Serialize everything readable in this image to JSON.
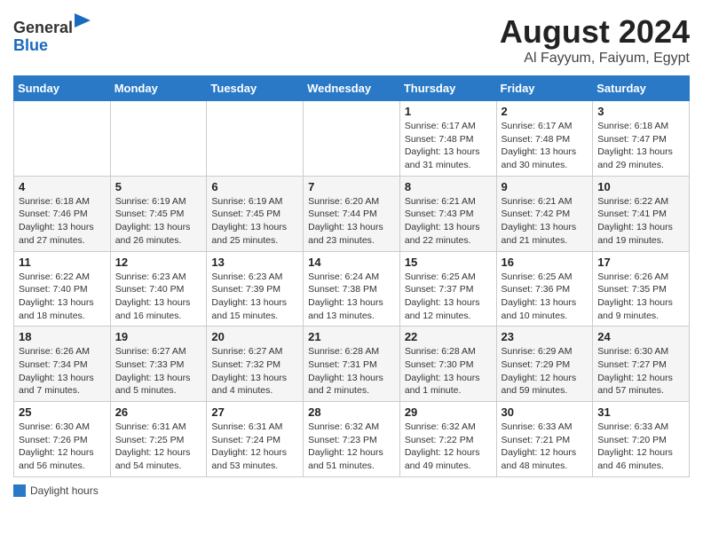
{
  "header": {
    "logo_line1": "General",
    "logo_line2": "Blue",
    "month": "August 2024",
    "location": "Al Fayyum, Faiyum, Egypt"
  },
  "days_of_week": [
    "Sunday",
    "Monday",
    "Tuesday",
    "Wednesday",
    "Thursday",
    "Friday",
    "Saturday"
  ],
  "weeks": [
    [
      {
        "day": "",
        "info": ""
      },
      {
        "day": "",
        "info": ""
      },
      {
        "day": "",
        "info": ""
      },
      {
        "day": "",
        "info": ""
      },
      {
        "day": "1",
        "info": "Sunrise: 6:17 AM\nSunset: 7:48 PM\nDaylight: 13 hours and 31 minutes."
      },
      {
        "day": "2",
        "info": "Sunrise: 6:17 AM\nSunset: 7:48 PM\nDaylight: 13 hours and 30 minutes."
      },
      {
        "day": "3",
        "info": "Sunrise: 6:18 AM\nSunset: 7:47 PM\nDaylight: 13 hours and 29 minutes."
      }
    ],
    [
      {
        "day": "4",
        "info": "Sunrise: 6:18 AM\nSunset: 7:46 PM\nDaylight: 13 hours and 27 minutes."
      },
      {
        "day": "5",
        "info": "Sunrise: 6:19 AM\nSunset: 7:45 PM\nDaylight: 13 hours and 26 minutes."
      },
      {
        "day": "6",
        "info": "Sunrise: 6:19 AM\nSunset: 7:45 PM\nDaylight: 13 hours and 25 minutes."
      },
      {
        "day": "7",
        "info": "Sunrise: 6:20 AM\nSunset: 7:44 PM\nDaylight: 13 hours and 23 minutes."
      },
      {
        "day": "8",
        "info": "Sunrise: 6:21 AM\nSunset: 7:43 PM\nDaylight: 13 hours and 22 minutes."
      },
      {
        "day": "9",
        "info": "Sunrise: 6:21 AM\nSunset: 7:42 PM\nDaylight: 13 hours and 21 minutes."
      },
      {
        "day": "10",
        "info": "Sunrise: 6:22 AM\nSunset: 7:41 PM\nDaylight: 13 hours and 19 minutes."
      }
    ],
    [
      {
        "day": "11",
        "info": "Sunrise: 6:22 AM\nSunset: 7:40 PM\nDaylight: 13 hours and 18 minutes."
      },
      {
        "day": "12",
        "info": "Sunrise: 6:23 AM\nSunset: 7:40 PM\nDaylight: 13 hours and 16 minutes."
      },
      {
        "day": "13",
        "info": "Sunrise: 6:23 AM\nSunset: 7:39 PM\nDaylight: 13 hours and 15 minutes."
      },
      {
        "day": "14",
        "info": "Sunrise: 6:24 AM\nSunset: 7:38 PM\nDaylight: 13 hours and 13 minutes."
      },
      {
        "day": "15",
        "info": "Sunrise: 6:25 AM\nSunset: 7:37 PM\nDaylight: 13 hours and 12 minutes."
      },
      {
        "day": "16",
        "info": "Sunrise: 6:25 AM\nSunset: 7:36 PM\nDaylight: 13 hours and 10 minutes."
      },
      {
        "day": "17",
        "info": "Sunrise: 6:26 AM\nSunset: 7:35 PM\nDaylight: 13 hours and 9 minutes."
      }
    ],
    [
      {
        "day": "18",
        "info": "Sunrise: 6:26 AM\nSunset: 7:34 PM\nDaylight: 13 hours and 7 minutes."
      },
      {
        "day": "19",
        "info": "Sunrise: 6:27 AM\nSunset: 7:33 PM\nDaylight: 13 hours and 5 minutes."
      },
      {
        "day": "20",
        "info": "Sunrise: 6:27 AM\nSunset: 7:32 PM\nDaylight: 13 hours and 4 minutes."
      },
      {
        "day": "21",
        "info": "Sunrise: 6:28 AM\nSunset: 7:31 PM\nDaylight: 13 hours and 2 minutes."
      },
      {
        "day": "22",
        "info": "Sunrise: 6:28 AM\nSunset: 7:30 PM\nDaylight: 13 hours and 1 minute."
      },
      {
        "day": "23",
        "info": "Sunrise: 6:29 AM\nSunset: 7:29 PM\nDaylight: 12 hours and 59 minutes."
      },
      {
        "day": "24",
        "info": "Sunrise: 6:30 AM\nSunset: 7:27 PM\nDaylight: 12 hours and 57 minutes."
      }
    ],
    [
      {
        "day": "25",
        "info": "Sunrise: 6:30 AM\nSunset: 7:26 PM\nDaylight: 12 hours and 56 minutes."
      },
      {
        "day": "26",
        "info": "Sunrise: 6:31 AM\nSunset: 7:25 PM\nDaylight: 12 hours and 54 minutes."
      },
      {
        "day": "27",
        "info": "Sunrise: 6:31 AM\nSunset: 7:24 PM\nDaylight: 12 hours and 53 minutes."
      },
      {
        "day": "28",
        "info": "Sunrise: 6:32 AM\nSunset: 7:23 PM\nDaylight: 12 hours and 51 minutes."
      },
      {
        "day": "29",
        "info": "Sunrise: 6:32 AM\nSunset: 7:22 PM\nDaylight: 12 hours and 49 minutes."
      },
      {
        "day": "30",
        "info": "Sunrise: 6:33 AM\nSunset: 7:21 PM\nDaylight: 12 hours and 48 minutes."
      },
      {
        "day": "31",
        "info": "Sunrise: 6:33 AM\nSunset: 7:20 PM\nDaylight: 12 hours and 46 minutes."
      }
    ]
  ],
  "legend": {
    "daylight_label": "Daylight hours"
  }
}
